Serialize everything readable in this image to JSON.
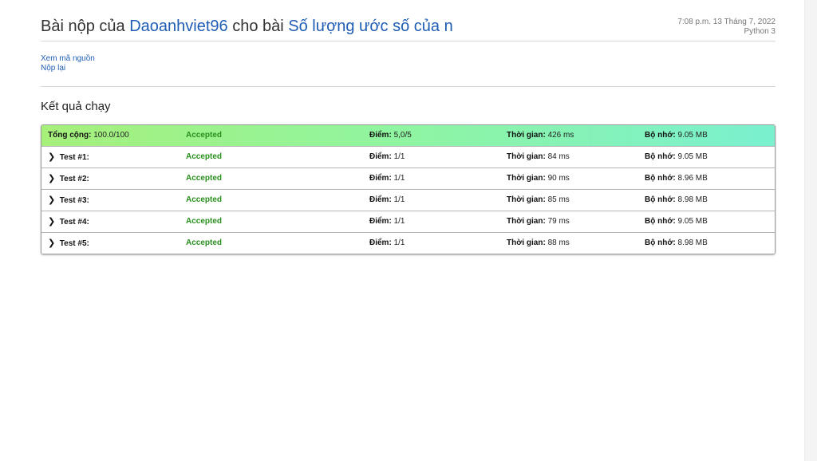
{
  "header": {
    "prefix": "Bài nộp của",
    "user": "Daoanhviet96",
    "middle": "cho bài",
    "problem": "Số lượng ước số của n",
    "datetime": "7:08 p.m. 13 Tháng 7, 2022",
    "language": "Python 3"
  },
  "links": {
    "view_source": "Xem mã nguồn",
    "resubmit": "Nộp lại"
  },
  "section_title": "Kết quả chạy",
  "labels": {
    "score": "Điểm:",
    "time": "Thời gian:",
    "memory": "Bộ nhớ:"
  },
  "total": {
    "label": "Tổng cộng:",
    "value": "100.0/100",
    "status": "Accepted",
    "score": "5,0/5",
    "time": "426 ms",
    "memory": "9.05 MB"
  },
  "tests": [
    {
      "label": "Test #1:",
      "status": "Accepted",
      "score": "1/1",
      "time": "84 ms",
      "memory": "9.05 MB"
    },
    {
      "label": "Test #2:",
      "status": "Accepted",
      "score": "1/1",
      "time": "90 ms",
      "memory": "8.96 MB"
    },
    {
      "label": "Test #3:",
      "status": "Accepted",
      "score": "1/1",
      "time": "85 ms",
      "memory": "8.98 MB"
    },
    {
      "label": "Test #4:",
      "status": "Accepted",
      "score": "1/1",
      "time": "79 ms",
      "memory": "9.05 MB"
    },
    {
      "label": "Test #5:",
      "status": "Accepted",
      "score": "1/1",
      "time": "88 ms",
      "memory": "8.98 MB"
    }
  ],
  "colors": {
    "link": "#1f5db4",
    "accepted": "#2a8f1e",
    "total_gradient_start": "#a6f07a",
    "total_gradient_end": "#7af0cf"
  }
}
